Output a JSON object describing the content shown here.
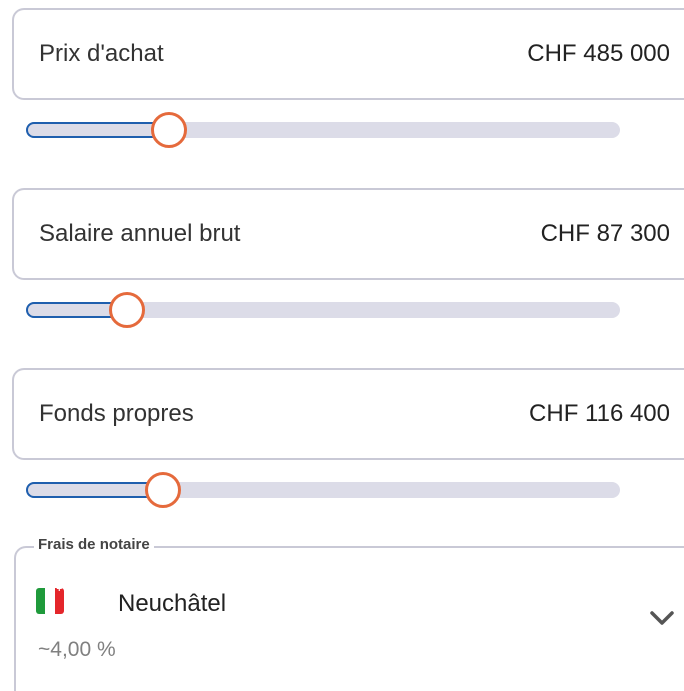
{
  "fields": [
    {
      "label": "Prix d'achat",
      "value": "CHF 485 000",
      "slider_fraction": 0.24
    },
    {
      "label": "Salaire annuel brut",
      "value": "CHF 87 300",
      "slider_fraction": 0.17
    },
    {
      "label": "Fonds propres",
      "value": "CHF 116 400",
      "slider_fraction": 0.23
    }
  ],
  "notary": {
    "legend": "Frais de notaire",
    "canton": "Neuchâtel",
    "rate": "~4,00 %",
    "flag_icon": "neuchatel-flag-icon",
    "chevron_icon": "chevron-down-icon"
  },
  "colors": {
    "accent": "#e56a3c",
    "slider_fill_border": "#1f5fae",
    "track": "#dcdce8"
  }
}
